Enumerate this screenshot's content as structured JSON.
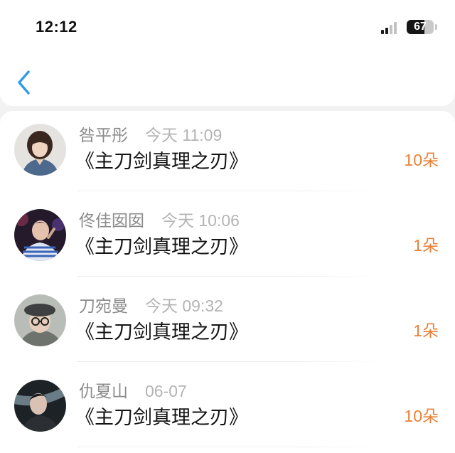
{
  "status_bar": {
    "time": "12:12",
    "battery": "67",
    "battery_level": 0.67,
    "signal_icon": "signal-bars-icon",
    "battery_icon": "battery-icon"
  },
  "header": {
    "back_icon": "chevron-left-icon"
  },
  "colors": {
    "accent": "#2f9be6",
    "count": "#e8823a",
    "name": "#8c8c8c",
    "time": "#b4b4b4",
    "title": "#141414"
  },
  "records": [
    {
      "name": "咎平彤",
      "time": "今天 11:09",
      "title": "《主刀剑真理之刃》",
      "count": "10朵"
    },
    {
      "name": "佟佳囡囡",
      "time": "今天 10:06",
      "title": "《主刀剑真理之刃》",
      "count": "1朵"
    },
    {
      "name": "刀宛曼",
      "time": "今天 09:32",
      "title": "《主刀剑真理之刃》",
      "count": "1朵"
    },
    {
      "name": "仇夏山",
      "time": "06-07",
      "title": "《主刀剑真理之刃》",
      "count": "10朵"
    }
  ]
}
